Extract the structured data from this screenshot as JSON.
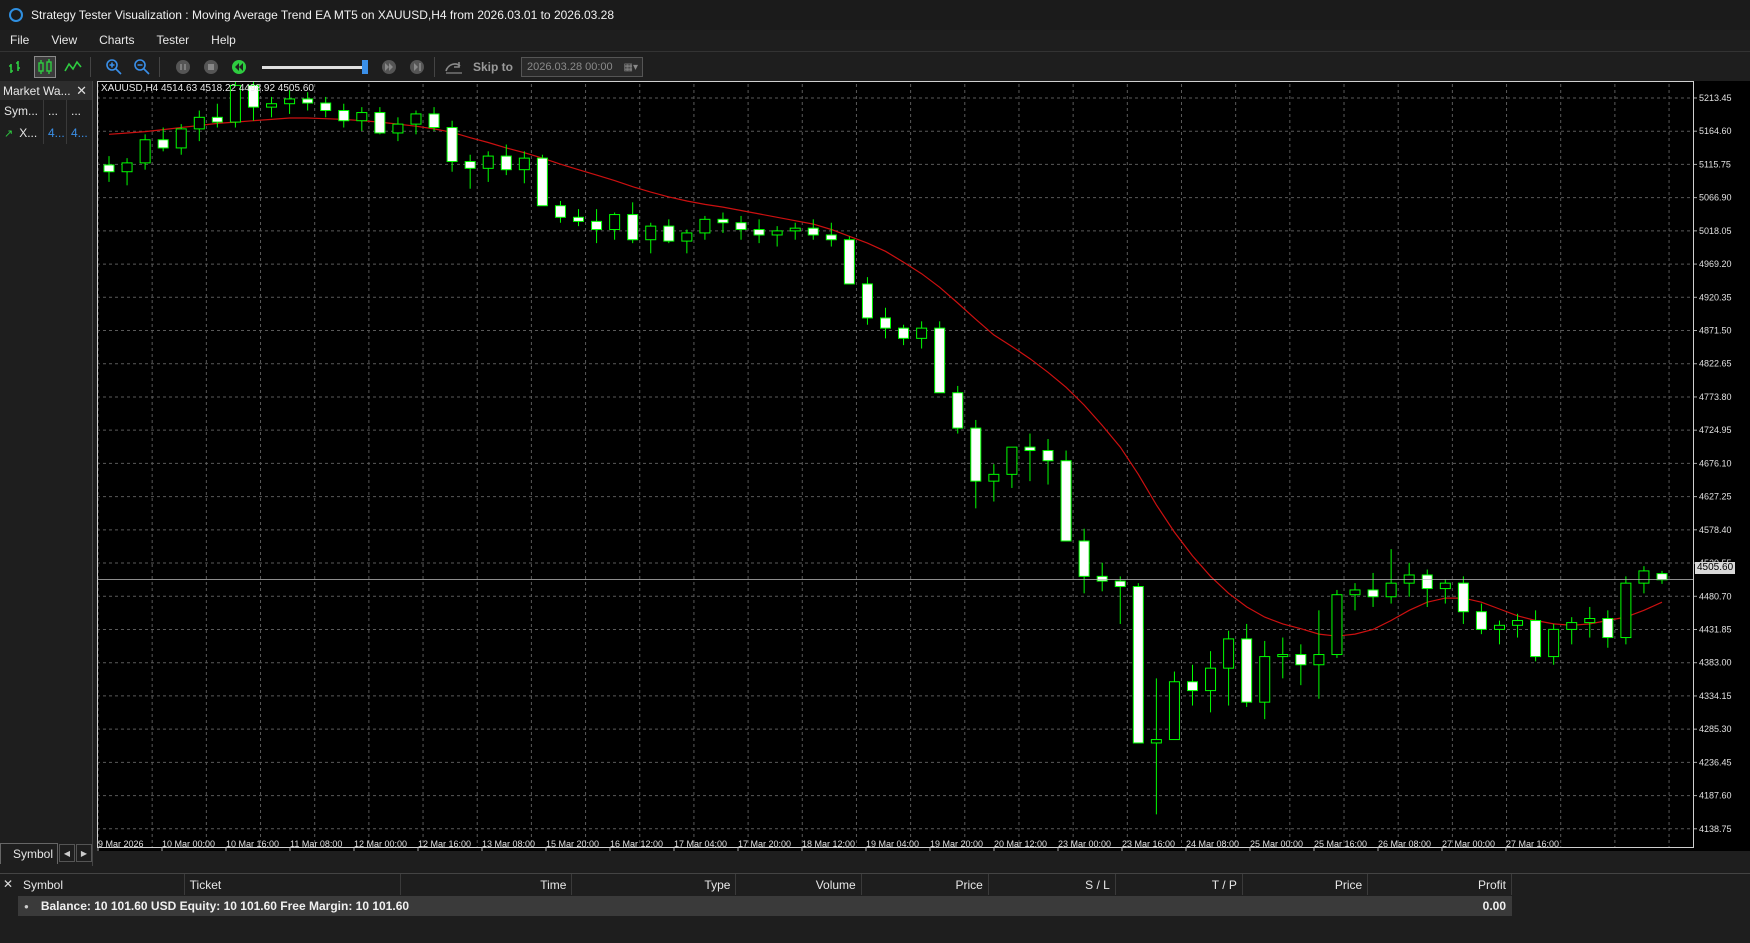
{
  "window": {
    "title": "Strategy Tester Visualization : Moving Average Trend EA MT5 on XAUUSD,H4 from 2026.03.01 to 2026.03.28"
  },
  "menu": [
    "File",
    "View",
    "Charts",
    "Tester",
    "Help"
  ],
  "toolbar": {
    "skip_label": "Skip to",
    "skip_date": "2026.03.28 00:00"
  },
  "market_watch": {
    "title": "Market Wa...",
    "header": [
      "Sym...",
      "...",
      "..."
    ],
    "rows": [
      [
        "X...",
        "4...",
        "4..."
      ]
    ],
    "tab": "Symbol"
  },
  "chart": {
    "info": "XAUUSD,H4  4514.63  4518.22  4498.92  4505.60",
    "current_price": "4505.60",
    "colors": {
      "bull": "#00ff00",
      "bear_fill": "#ffffff",
      "ma": "#cc1010",
      "grid": "#5a5a5a",
      "bg": "#000000",
      "axis_text": "#e0e0e0"
    }
  },
  "chart_data": {
    "type": "candlestick",
    "symbol": "XAUUSD",
    "timeframe": "H4",
    "y_ticks": [
      "5213.45",
      "5164.60",
      "5115.75",
      "5066.90",
      "5018.05",
      "4969.20",
      "4920.35",
      "4871.50",
      "4822.65",
      "4773.80",
      "4724.95",
      "4676.10",
      "4627.25",
      "4578.40",
      "4529.55",
      "4480.70",
      "4431.85",
      "4383.00",
      "4334.15",
      "4285.30",
      "4236.45",
      "4187.60",
      "4138.75"
    ],
    "x_ticks": [
      "9 Mar 2026",
      "10 Mar 00:00",
      "10 Mar 16:00",
      "11 Mar 08:00",
      "12 Mar 00:00",
      "12 Mar 16:00",
      "13 Mar 08:00",
      "15 Mar 20:00",
      "16 Mar 12:00",
      "17 Mar 04:00",
      "17 Mar 20:00",
      "18 Mar 12:00",
      "19 Mar 04:00",
      "19 Mar 20:00",
      "20 Mar 12:00",
      "23 Mar 00:00",
      "23 Mar 16:00",
      "24 Mar 08:00",
      "25 Mar 00:00",
      "25 Mar 16:00",
      "26 Mar 08:00",
      "27 Mar 00:00",
      "27 Mar 16:00"
    ],
    "ylim": [
      4112,
      5234
    ],
    "ohlc": [
      [
        5115,
        5128,
        5090,
        5105
      ],
      [
        5105,
        5125,
        5085,
        5118
      ],
      [
        5118,
        5160,
        5108,
        5152
      ],
      [
        5152,
        5170,
        5135,
        5140
      ],
      [
        5140,
        5175,
        5130,
        5168
      ],
      [
        5168,
        5195,
        5150,
        5185
      ],
      [
        5185,
        5205,
        5170,
        5178
      ],
      [
        5178,
        5240,
        5170,
        5232
      ],
      [
        5232,
        5240,
        5180,
        5200
      ],
      [
        5200,
        5215,
        5185,
        5205
      ],
      [
        5205,
        5225,
        5190,
        5212
      ],
      [
        5212,
        5222,
        5195,
        5206
      ],
      [
        5206,
        5215,
        5185,
        5195
      ],
      [
        5195,
        5205,
        5170,
        5180
      ],
      [
        5180,
        5200,
        5165,
        5192
      ],
      [
        5192,
        5200,
        5160,
        5162
      ],
      [
        5162,
        5185,
        5150,
        5175
      ],
      [
        5175,
        5195,
        5160,
        5190
      ],
      [
        5190,
        5200,
        5165,
        5170
      ],
      [
        5170,
        5180,
        5105,
        5120
      ],
      [
        5120,
        5130,
        5080,
        5110
      ],
      [
        5110,
        5135,
        5090,
        5128
      ],
      [
        5128,
        5145,
        5100,
        5108
      ],
      [
        5108,
        5135,
        5088,
        5125
      ],
      [
        5125,
        5130,
        5060,
        5055
      ],
      [
        5055,
        5062,
        5030,
        5038
      ],
      [
        5038,
        5050,
        5025,
        5032
      ],
      [
        5032,
        5050,
        5000,
        5020
      ],
      [
        5020,
        5045,
        5005,
        5042
      ],
      [
        5042,
        5060,
        5000,
        5005
      ],
      [
        5005,
        5030,
        4985,
        5025
      ],
      [
        5025,
        5035,
        5000,
        5003
      ],
      [
        5003,
        5020,
        4985,
        5015
      ],
      [
        5015,
        5040,
        5005,
        5035
      ],
      [
        5035,
        5045,
        5015,
        5030
      ],
      [
        5030,
        5040,
        5005,
        5020
      ],
      [
        5020,
        5035,
        5000,
        5012
      ],
      [
        5012,
        5025,
        4995,
        5018
      ],
      [
        5018,
        5030,
        5005,
        5022
      ],
      [
        5022,
        5035,
        5005,
        5012
      ],
      [
        5012,
        5030,
        4995,
        5005
      ],
      [
        5005,
        5010,
        4960,
        4940
      ],
      [
        4940,
        4950,
        4880,
        4890
      ],
      [
        4890,
        4905,
        4860,
        4875
      ],
      [
        4875,
        4880,
        4850,
        4860
      ],
      [
        4860,
        4885,
        4845,
        4875
      ],
      [
        4875,
        4885,
        4780,
        4780
      ],
      [
        4780,
        4790,
        4720,
        4728
      ],
      [
        4728,
        4740,
        4610,
        4650
      ],
      [
        4650,
        4675,
        4620,
        4660
      ],
      [
        4660,
        4700,
        4640,
        4700
      ],
      [
        4700,
        4720,
        4650,
        4695
      ],
      [
        4695,
        4712,
        4645,
        4680
      ],
      [
        4680,
        4695,
        4600,
        4562
      ],
      [
        4562,
        4580,
        4485,
        4510
      ],
      [
        4510,
        4530,
        4488,
        4503
      ],
      [
        4503,
        4510,
        4440,
        4495
      ],
      [
        4495,
        4500,
        4325,
        4265
      ],
      [
        4265,
        4360,
        4160,
        4270
      ],
      [
        4270,
        4370,
        4300,
        4355
      ],
      [
        4355,
        4380,
        4320,
        4342
      ],
      [
        4342,
        4400,
        4310,
        4375
      ],
      [
        4375,
        4430,
        4320,
        4418
      ],
      [
        4418,
        4440,
        4318,
        4325
      ],
      [
        4325,
        4415,
        4300,
        4392
      ],
      [
        4392,
        4420,
        4360,
        4395
      ],
      [
        4395,
        4410,
        4350,
        4380
      ],
      [
        4380,
        4460,
        4330,
        4395
      ],
      [
        4395,
        4490,
        4390,
        4483
      ],
      [
        4483,
        4500,
        4460,
        4490
      ],
      [
        4490,
        4515,
        4465,
        4480
      ],
      [
        4480,
        4550,
        4470,
        4500
      ],
      [
        4500,
        4530,
        4480,
        4512
      ],
      [
        4512,
        4520,
        4465,
        4492
      ],
      [
        4492,
        4505,
        4470,
        4500
      ],
      [
        4500,
        4510,
        4440,
        4458
      ],
      [
        4458,
        4470,
        4425,
        4432
      ],
      [
        4432,
        4445,
        4410,
        4438
      ],
      [
        4438,
        4455,
        4420,
        4445
      ],
      [
        4445,
        4460,
        4385,
        4392
      ],
      [
        4392,
        4440,
        4380,
        4432
      ],
      [
        4432,
        4450,
        4410,
        4442
      ],
      [
        4442,
        4465,
        4420,
        4448
      ],
      [
        4448,
        4460,
        4405,
        4420
      ],
      [
        4420,
        4510,
        4410,
        4500
      ],
      [
        4500,
        4525,
        4485,
        4518
      ],
      [
        4514,
        4518,
        4499,
        4505
      ]
    ],
    "ma": [
      5160,
      5162,
      5164,
      5167,
      5170,
      5173,
      5176,
      5178,
      5180,
      5182,
      5184,
      5184,
      5183,
      5182,
      5180,
      5178,
      5175,
      5172,
      5168,
      5163,
      5155,
      5148,
      5140,
      5133,
      5125,
      5116,
      5108,
      5100,
      5092,
      5083,
      5075,
      5068,
      5062,
      5057,
      5053,
      5048,
      5043,
      5038,
      5033,
      5028,
      5020,
      5010,
      5000,
      4988,
      4972,
      4955,
      4935,
      4912,
      4888,
      4865,
      4848,
      4830,
      4810,
      4788,
      4762,
      4732,
      4700,
      4660,
      4615,
      4575,
      4540,
      4510,
      4485,
      4465,
      4450,
      4440,
      4433,
      4425,
      4422,
      4425,
      4432,
      4445,
      4460,
      4472,
      4478,
      4478,
      4472,
      4462,
      4452,
      4445,
      4440,
      4438,
      4440,
      4445,
      4450,
      4460,
      4472
    ],
    "current_price": 4505.6
  },
  "trade_panel": {
    "columns": [
      "Symbol",
      "Ticket",
      "Time",
      "Type",
      "Volume",
      "Price",
      "S / L",
      "T / P",
      "Price",
      "Profit"
    ],
    "balance_text": "Balance: 10 101.60 USD  Equity: 10 101.60  Free Margin: 10 101.60",
    "profit": "0.00"
  }
}
